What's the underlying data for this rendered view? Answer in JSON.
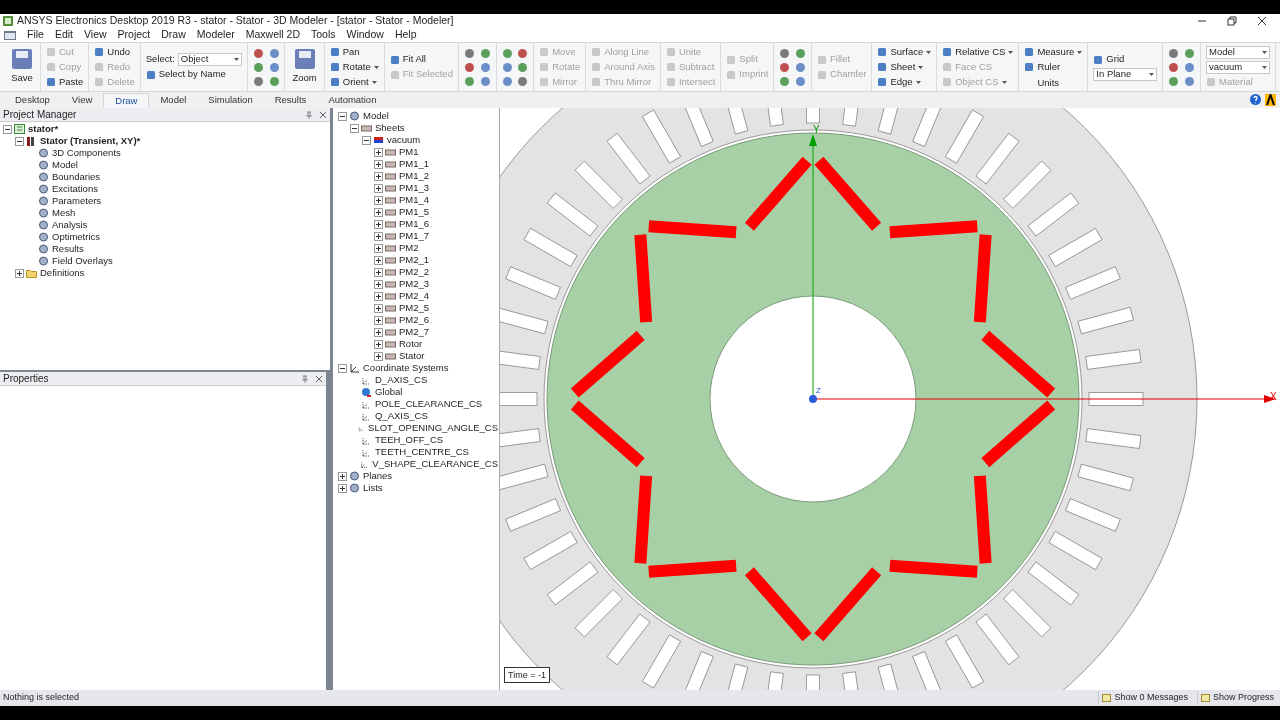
{
  "window": {
    "title": "ANSYS Electronics Desktop 2019 R3 - stator - Stator - 3D Modeler - [stator - Stator - Modeler]"
  },
  "menu": [
    "File",
    "Edit",
    "View",
    "Project",
    "Draw",
    "Modeler",
    "Maxwell 2D",
    "Tools",
    "Window",
    "Help"
  ],
  "ribbon": [
    {
      "kind": "large",
      "label": "Save",
      "disabled": false
    },
    {
      "kind": "column",
      "items": [
        {
          "kind": "button",
          "label": "Cut",
          "disabled": true
        },
        {
          "kind": "button",
          "label": "Copy",
          "disabled": true
        },
        {
          "kind": "button",
          "label": "Paste",
          "disabled": false
        }
      ]
    },
    {
      "kind": "column",
      "items": [
        {
          "kind": "button",
          "label": "Undo",
          "disabled": false
        },
        {
          "kind": "button",
          "label": "Redo",
          "disabled": true
        },
        {
          "kind": "button",
          "label": "Delete",
          "disabled": true
        }
      ]
    },
    {
      "kind": "column",
      "items": [
        {
          "kind": "select",
          "label": "Select:",
          "value": "Object"
        },
        {
          "kind": "button",
          "label": "Select by Name",
          "disabled": false
        }
      ]
    },
    {
      "kind": "icon_grid"
    },
    {
      "kind": "large",
      "label": "Zoom",
      "disabled": false
    },
    {
      "kind": "column",
      "items": [
        {
          "kind": "button",
          "label": "Pan",
          "disabled": false
        },
        {
          "kind": "button",
          "label": "Rotate",
          "disabled": false,
          "dropdown": true
        },
        {
          "kind": "button",
          "label": "Orient",
          "disabled": false,
          "dropdown": true
        }
      ]
    },
    {
      "kind": "column",
      "items": [
        {
          "kind": "button",
          "label": "Fit All",
          "disabled": false
        },
        {
          "kind": "button",
          "label": "Fit Selected",
          "disabled": true
        }
      ]
    },
    {
      "kind": "icon_grid"
    },
    {
      "kind": "icon_grid"
    },
    {
      "kind": "column",
      "items": [
        {
          "kind": "button",
          "label": "Move",
          "disabled": true
        },
        {
          "kind": "button",
          "label": "Rotate",
          "disabled": true
        },
        {
          "kind": "button",
          "label": "Mirror",
          "disabled": true
        }
      ]
    },
    {
      "kind": "column",
      "items": [
        {
          "kind": "button",
          "label": "Along Line",
          "disabled": true
        },
        {
          "kind": "button",
          "label": "Around Axis",
          "disabled": true
        },
        {
          "kind": "button",
          "label": "Thru Mirror",
          "disabled": true
        }
      ]
    },
    {
      "kind": "column",
      "items": [
        {
          "kind": "button",
          "label": "Unite",
          "disabled": true
        },
        {
          "kind": "button",
          "label": "Subtract",
          "disabled": true
        },
        {
          "kind": "button",
          "label": "Intersect",
          "disabled": true
        }
      ]
    },
    {
      "kind": "column",
      "items": [
        {
          "kind": "button",
          "label": "Split",
          "disabled": true
        },
        {
          "kind": "button",
          "label": "Imprint",
          "disabled": true
        }
      ]
    },
    {
      "kind": "icon_grid"
    },
    {
      "kind": "column",
      "items": [
        {
          "kind": "button",
          "label": "Fillet",
          "disabled": true
        },
        {
          "kind": "button",
          "label": "Chamfer",
          "disabled": true
        }
      ]
    },
    {
      "kind": "column",
      "items": [
        {
          "kind": "button",
          "label": "Surface",
          "disabled": false,
          "dropdown": true
        },
        {
          "kind": "button",
          "label": "Sheet",
          "disabled": false,
          "dropdown": true
        },
        {
          "kind": "button",
          "label": "Edge",
          "disabled": false,
          "dropdown": true
        }
      ]
    },
    {
      "kind": "column",
      "items": [
        {
          "kind": "button",
          "label": "Relative CS",
          "disabled": false,
          "dropdown": true
        },
        {
          "kind": "button",
          "label": "Face CS",
          "disabled": true
        },
        {
          "kind": "button",
          "label": "Object CS",
          "disabled": true,
          "dropdown": true
        }
      ]
    },
    {
      "kind": "column",
      "items": [
        {
          "kind": "button",
          "label": "Measure",
          "disabled": false,
          "dropdown": true
        },
        {
          "kind": "button",
          "label": "Ruler",
          "disabled": false
        },
        {
          "kind": "text",
          "label": "Units"
        }
      ]
    },
    {
      "kind": "column",
      "items": [
        {
          "kind": "button",
          "label": "Grid",
          "disabled": false
        },
        {
          "kind": "select",
          "value": "In Plane"
        }
      ]
    },
    {
      "kind": "icon_grid"
    },
    {
      "kind": "column",
      "items": [
        {
          "kind": "select",
          "value": "Model"
        },
        {
          "kind": "select",
          "value": "vacuum"
        },
        {
          "kind": "button",
          "label": "Material",
          "disabled": true
        }
      ]
    }
  ],
  "ribbon_tabs": [
    {
      "label": "Desktop",
      "selected": false
    },
    {
      "label": "View",
      "selected": false
    },
    {
      "label": "Draw",
      "selected": true
    },
    {
      "label": "Model",
      "selected": false
    },
    {
      "label": "Simulation",
      "selected": false
    },
    {
      "label": "Results",
      "selected": false
    },
    {
      "label": "Automation",
      "selected": false
    }
  ],
  "project_manager": {
    "title": "Project Manager",
    "tree": [
      {
        "label": "stator*",
        "kind": "project",
        "expanded": true,
        "children": [
          {
            "label": "Stator (Transient, XY)*",
            "kind": "design",
            "expanded": true,
            "children": [
              {
                "label": "3D Components",
                "kind": "item"
              },
              {
                "label": "Model",
                "kind": "item"
              },
              {
                "label": "Boundaries",
                "kind": "item"
              },
              {
                "label": "Excitations",
                "kind": "item"
              },
              {
                "label": "Parameters",
                "kind": "item"
              },
              {
                "label": "Mesh",
                "kind": "item"
              },
              {
                "label": "Analysis",
                "kind": "item"
              },
              {
                "label": "Optimetrics",
                "kind": "item"
              },
              {
                "label": "Results",
                "kind": "item"
              },
              {
                "label": "Field Overlays",
                "kind": "item"
              }
            ]
          },
          {
            "label": "Definitions",
            "kind": "folder",
            "expanded": false
          }
        ]
      }
    ]
  },
  "properties": {
    "title": "Properties"
  },
  "model_tree": [
    {
      "label": "Model",
      "kind": "item",
      "expanded": true,
      "children": [
        {
          "label": "Sheets",
          "kind": "sheet",
          "expanded": true,
          "children": [
            {
              "label": "vacuum",
              "kind": "material",
              "expanded": true,
              "children": [
                {
                  "label": "PM1",
                  "kind": "sheet",
                  "expanded": false
                },
                {
                  "label": "PM1_1",
                  "kind": "sheet",
                  "expanded": false
                },
                {
                  "label": "PM1_2",
                  "kind": "sheet",
                  "expanded": false
                },
                {
                  "label": "PM1_3",
                  "kind": "sheet",
                  "expanded": false
                },
                {
                  "label": "PM1_4",
                  "kind": "sheet",
                  "expanded": false
                },
                {
                  "label": "PM1_5",
                  "kind": "sheet",
                  "expanded": false
                },
                {
                  "label": "PM1_6",
                  "kind": "sheet",
                  "expanded": false
                },
                {
                  "label": "PM1_7",
                  "kind": "sheet",
                  "expanded": false
                },
                {
                  "label": "PM2",
                  "kind": "sheet",
                  "expanded": false
                },
                {
                  "label": "PM2_1",
                  "kind": "sheet",
                  "expanded": false
                },
                {
                  "label": "PM2_2",
                  "kind": "sheet",
                  "expanded": false
                },
                {
                  "label": "PM2_3",
                  "kind": "sheet",
                  "expanded": false
                },
                {
                  "label": "PM2_4",
                  "kind": "sheet",
                  "expanded": false
                },
                {
                  "label": "PM2_5",
                  "kind": "sheet",
                  "expanded": false
                },
                {
                  "label": "PM2_6",
                  "kind": "sheet",
                  "expanded": false
                },
                {
                  "label": "PM2_7",
                  "kind": "sheet",
                  "expanded": false
                },
                {
                  "label": "Rotor",
                  "kind": "sheet",
                  "expanded": false
                },
                {
                  "label": "Stator",
                  "kind": "sheet",
                  "expanded": false
                }
              ]
            }
          ]
        }
      ]
    },
    {
      "label": "Coordinate Systems",
      "kind": "axes",
      "expanded": true,
      "children": [
        {
          "label": "D_AXIS_CS",
          "kind": "cs"
        },
        {
          "label": "Global",
          "kind": "globe"
        },
        {
          "label": "POLE_CLEARANCE_CS",
          "kind": "cs"
        },
        {
          "label": "Q_AXIS_CS",
          "kind": "cs"
        },
        {
          "label": "SLOT_OPENING_ANGLE_CS",
          "kind": "cs"
        },
        {
          "label": "TEEH_OFF_CS",
          "kind": "cs"
        },
        {
          "label": "TEETH_CENTRE_CS",
          "kind": "cs"
        },
        {
          "label": "V_SHAPE_CLEARANCE_CS",
          "kind": "cs"
        }
      ]
    },
    {
      "label": "Planes",
      "kind": "item",
      "expanded": false
    },
    {
      "label": "Lists",
      "kind": "item",
      "expanded": false
    }
  ],
  "viewport": {
    "x_axis_label": "X",
    "y_axis_label": "Y",
    "z_axis_label": "Z",
    "time_label": "Time = -1"
  },
  "status_bar": {
    "message": "Nothing is selected",
    "buttons": [
      "Show 0 Messages",
      "Show Progress"
    ]
  }
}
